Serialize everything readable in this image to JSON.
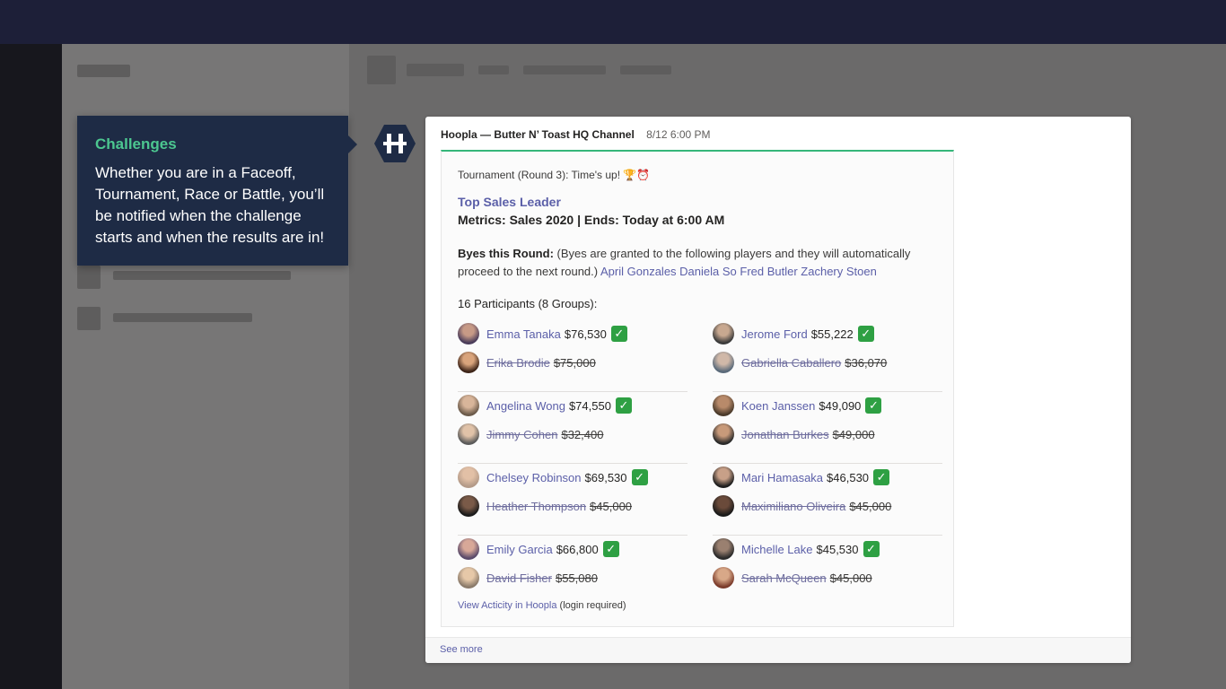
{
  "tooltip": {
    "title": "Challenges",
    "body": "Whether you are in a Faceoff, Tournament, Race or Battle, you’ll be notified when the challenge starts and when the results are in!"
  },
  "message": {
    "sender": "Hoopla — Butter N’ Toast HQ Channel",
    "timestamp": "8/12 6:00 PM",
    "tournament_line": "Tournament (Round 3): Time's up! 🏆⏰",
    "leader_title": "Top Sales Leader",
    "metrics": "Metrics: Sales 2020  |  Ends: Today at 6:00 AM",
    "byes_label": "Byes this Round:",
    "byes_text": "(Byes are granted to the following players and they will automatically proceed to the next round.)",
    "byes_names": "April Gonzales Daniela So Fred Butler Zachery Stoen",
    "participants_label": "16 Participants (8 Groups):",
    "view_link": "View Acticity in Hoopla",
    "view_suffix": "(login required)",
    "see_more": "See more"
  },
  "groups_left": [
    {
      "winner": {
        "name": "Emma Tanaka",
        "value": "$76,530"
      },
      "loser": {
        "name": "Erika Brodie",
        "value": "$75,000"
      }
    },
    {
      "winner": {
        "name": "Angelina Wong",
        "value": "$74,550"
      },
      "loser": {
        "name": "Jimmy Cohen",
        "value": "$32,400"
      }
    },
    {
      "winner": {
        "name": "Chelsey Robinson",
        "value": "$69,530"
      },
      "loser": {
        "name": "Heather Thompson",
        "value": "$45,000"
      }
    },
    {
      "winner": {
        "name": "Emily Garcia",
        "value": "$66,800"
      },
      "loser": {
        "name": "David Fisher",
        "value": "$55,080"
      }
    }
  ],
  "groups_right": [
    {
      "winner": {
        "name": "Jerome Ford",
        "value": "$55,222"
      },
      "loser": {
        "name": "Gabriella Caballero",
        "value": "$36,070"
      }
    },
    {
      "winner": {
        "name": "Koen Janssen",
        "value": "$49,090"
      },
      "loser": {
        "name": "Jonathan Burkes",
        "value": "$49,000"
      }
    },
    {
      "winner": {
        "name": "Mari Hamasaka",
        "value": "$46,530"
      },
      "loser": {
        "name": "Maximiliano Oliveira",
        "value": "$45,000"
      }
    },
    {
      "winner": {
        "name": "Michelle Lake",
        "value": "$45,530"
      },
      "loser": {
        "name": "Sarah McQueen",
        "value": "$45,000"
      }
    }
  ],
  "check_glyph": "✓",
  "colors": {
    "accent_green": "#35b67a",
    "link_purple": "#5b5fa8",
    "tooltip_bg": "#1e2b45",
    "check_green": "#2ea043"
  }
}
